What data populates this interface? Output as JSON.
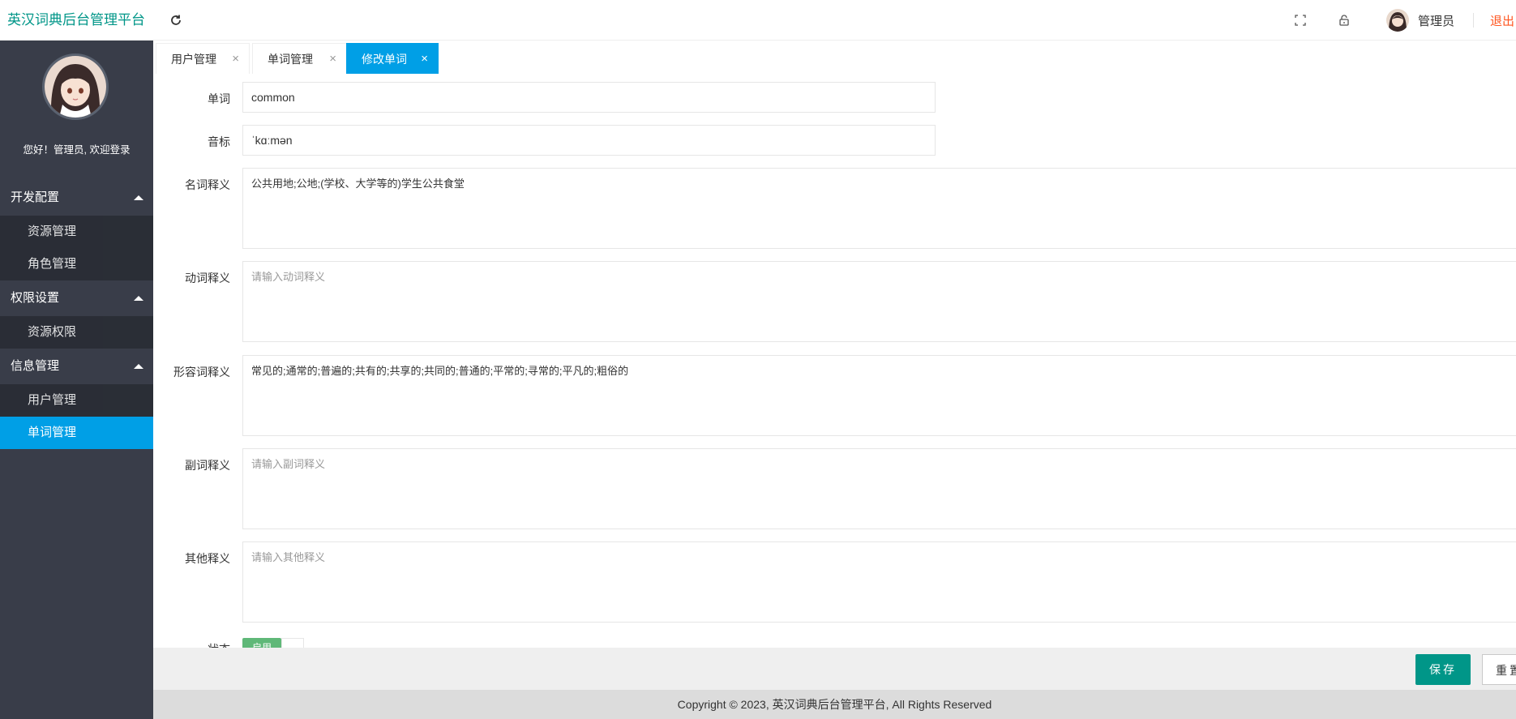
{
  "header": {
    "logo": "英汉词典后台管理平台",
    "user_name": "管理员",
    "logout": "退出"
  },
  "sidebar": {
    "welcome": "您好！管理员, 欢迎登录",
    "groups": [
      {
        "label": "开发配置",
        "items": [
          "资源管理",
          "角色管理"
        ]
      },
      {
        "label": "权限设置",
        "items": [
          "资源权限"
        ]
      },
      {
        "label": "信息管理",
        "items": [
          "用户管理",
          "单词管理"
        ]
      }
    ]
  },
  "tabs": [
    {
      "label": "用户管理",
      "close": "×"
    },
    {
      "label": "单词管理",
      "close": "×"
    },
    {
      "label": "修改单词",
      "close": "×"
    }
  ],
  "form": {
    "word": {
      "label": "单词",
      "value": "common"
    },
    "phonetic": {
      "label": "音标",
      "value": "ˈkɑːmən"
    },
    "noun": {
      "label": "名词释义",
      "value": "公共用地;公地;(学校、大学等的)学生公共食堂",
      "placeholder": ""
    },
    "verb": {
      "label": "动词释义",
      "value": "",
      "placeholder": "请输入动词释义"
    },
    "adjective": {
      "label": "形容词释义",
      "value": "常见的;通常的;普遍的;共有的;共享的;共同的;普通的;平常的;寻常的;平凡的;粗俗的",
      "placeholder": ""
    },
    "adverb": {
      "label": "副词释义",
      "value": "",
      "placeholder": "请输入副词释义"
    },
    "other": {
      "label": "其他释义",
      "value": "",
      "placeholder": "请输入其他释义"
    },
    "status": {
      "label": "状态",
      "switch_text": "启用"
    }
  },
  "actions": {
    "save": "保存",
    "reset": "重置"
  },
  "footer": {
    "copyright": "Copyright © 2023, 英汉词典后台管理平台, All Rights Reserved"
  },
  "colors": {
    "brand": "#009688",
    "sidebar_bg": "#393D49",
    "active": "#009FE6",
    "logout": "#FF5722"
  }
}
